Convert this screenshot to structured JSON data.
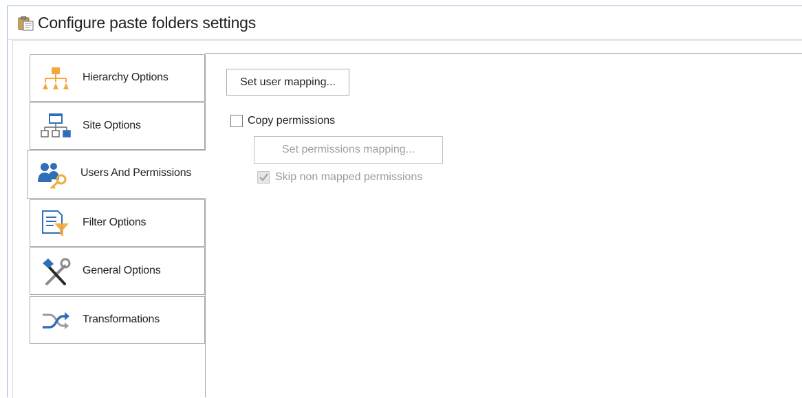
{
  "window": {
    "title": "Configure paste folders settings",
    "title_icon": "clipboard-paste-icon"
  },
  "sidebar": {
    "tabs": [
      {
        "label": "Hierarchy Options",
        "icon": "hierarchy-icon",
        "active": false
      },
      {
        "label": "Site Options",
        "icon": "site-structure-icon",
        "active": false
      },
      {
        "label": "Users And Permissions",
        "icon": "users-key-icon",
        "active": true
      },
      {
        "label": "Filter Options",
        "icon": "filter-icon",
        "active": false
      },
      {
        "label": "General Options",
        "icon": "tools-icon",
        "active": false
      },
      {
        "label": "Transformations",
        "icon": "shuffle-icon",
        "active": false
      }
    ]
  },
  "users_permissions": {
    "set_user_mapping_label": "Set user mapping...",
    "copy_permissions_label": "Copy permissions",
    "copy_permissions_checked": false,
    "set_permissions_mapping_label": "Set permissions mapping...",
    "set_permissions_mapping_enabled": false,
    "skip_non_mapped_label": "Skip non mapped permissions",
    "skip_non_mapped_checked": true,
    "skip_non_mapped_enabled": false
  },
  "colors": {
    "accent_blue": "#2f6fb8",
    "accent_orange": "#f2a93b",
    "border_gray": "#a9a9a9"
  }
}
